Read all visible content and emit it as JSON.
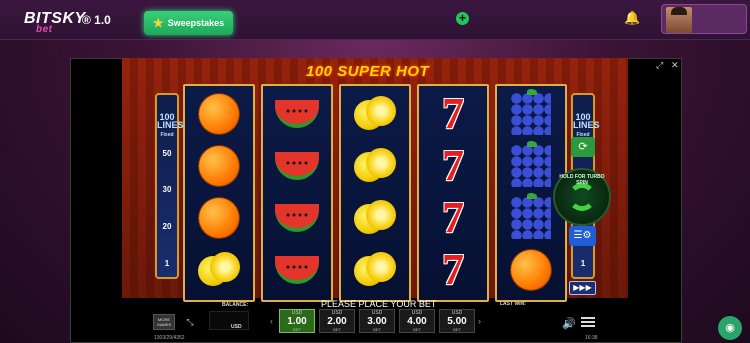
{
  "header": {
    "logo_main": "BITSKY",
    "logo_sub": "bet",
    "version": "® 1.0",
    "sweepstakes_label": "Sweepstakes",
    "add_label": "+"
  },
  "game": {
    "title": "100 SUPER HOT",
    "left_lines_title": "100 LINES",
    "left_lines_sub": "Fixed",
    "left_numbers": [
      "50",
      "30",
      "20",
      "1"
    ],
    "right_lines_title": "100 LINES",
    "right_lines_sub": "Fixed",
    "right_numbers": [
      "1"
    ],
    "turbo_text": "HOLD FOR TURBO SPIN",
    "reels": [
      [
        "orange",
        "orange",
        "orange",
        "lemon"
      ],
      [
        "melon",
        "melon",
        "melon",
        "melon"
      ],
      [
        "lemon",
        "lemon",
        "lemon",
        "lemon"
      ],
      [
        "seven",
        "seven",
        "seven",
        "seven"
      ],
      [
        "grapes",
        "grapes",
        "grapes",
        "orange"
      ]
    ]
  },
  "controls": {
    "message": "PLEASE PLACE YOUR BET",
    "balance_label": "BALANCE:",
    "balance_currency": "USD",
    "last_win_label": "LAST WIN:",
    "more_games_label": "MORE GAMES",
    "bets": [
      {
        "currency": "USD",
        "value": "1.00",
        "label": "BET",
        "active": true
      },
      {
        "currency": "USD",
        "value": "2.00",
        "label": "BET",
        "active": false
      },
      {
        "currency": "USD",
        "value": "3.00",
        "label": "BET",
        "active": false
      },
      {
        "currency": "USD",
        "value": "4.00",
        "label": "BET",
        "active": false
      },
      {
        "currency": "USD",
        "value": "5.00",
        "label": "BET",
        "active": false
      }
    ],
    "ticket_id": "1303/29/4352",
    "time": "16:38"
  },
  "colors": {
    "accent_green": "#1ea85a",
    "title_yellow": "#ffd400",
    "reel_border": "#e0b040"
  }
}
